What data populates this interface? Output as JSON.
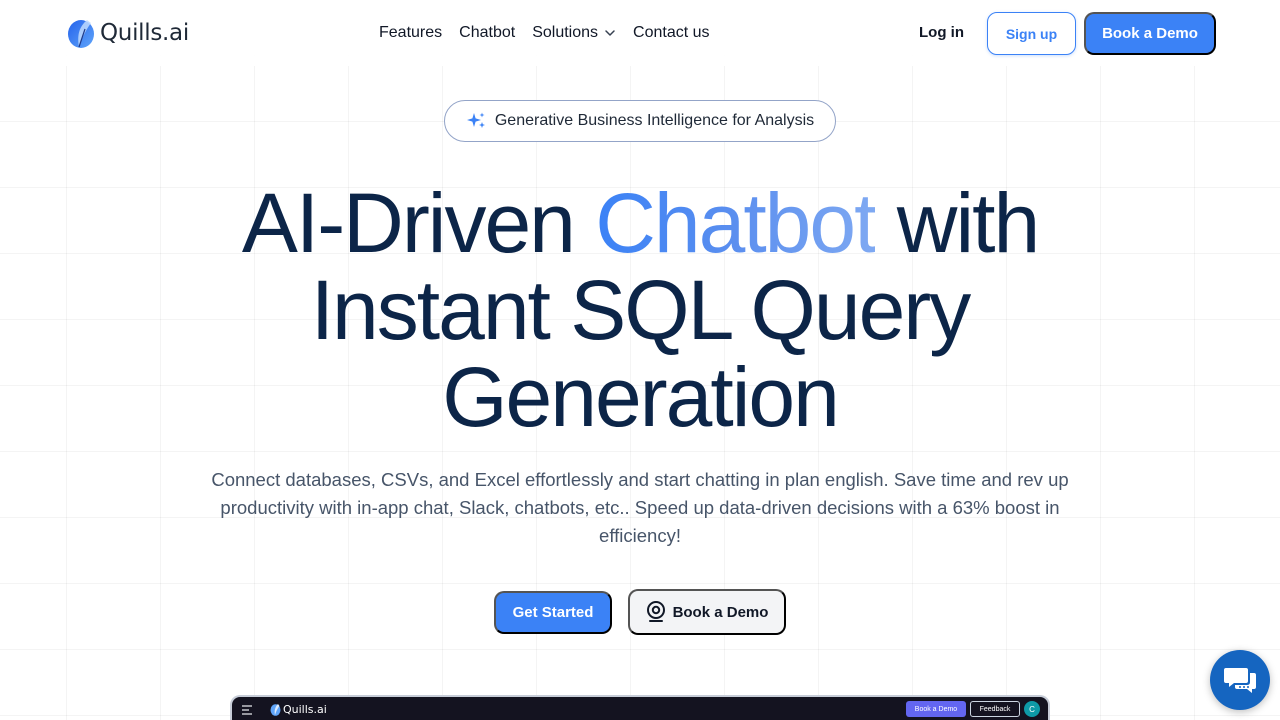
{
  "header": {
    "logo_text": "Quills.ai",
    "nav": [
      {
        "label": "Features"
      },
      {
        "label": "Chatbot"
      },
      {
        "label": "Solutions"
      },
      {
        "label": "Contact us"
      }
    ],
    "login_label": "Log in",
    "signup_label": "Sign up",
    "book_demo_label": "Book a Demo"
  },
  "badge": {
    "icon": "sparkle-icon",
    "text": "Generative Business Intelligence for Analysis"
  },
  "hero": {
    "headline_pre": "AI-Driven ",
    "headline_accent": "Chatbot",
    "headline_post": " with Instant SQL Query Generation",
    "subtitle": "Connect databases, CSVs, and Excel effortlessly and start chatting in plan english. Save time and rev up productivity with in-app chat, Slack, chatbots, etc.. Speed up data-driven decisions with a 63% boost in efficiency!",
    "get_started_label": "Get Started",
    "book_demo_label": "Book a Demo"
  },
  "preview": {
    "logo_text": "Quills.ai",
    "book_demo_label": "Book a Demo",
    "feedback_label": "Feedback",
    "avatar_initial": "C"
  },
  "colors": {
    "primary": "#3b82f6",
    "headline": "#0c2548",
    "body_text": "#475569",
    "chat_widget": "#1565c0"
  }
}
